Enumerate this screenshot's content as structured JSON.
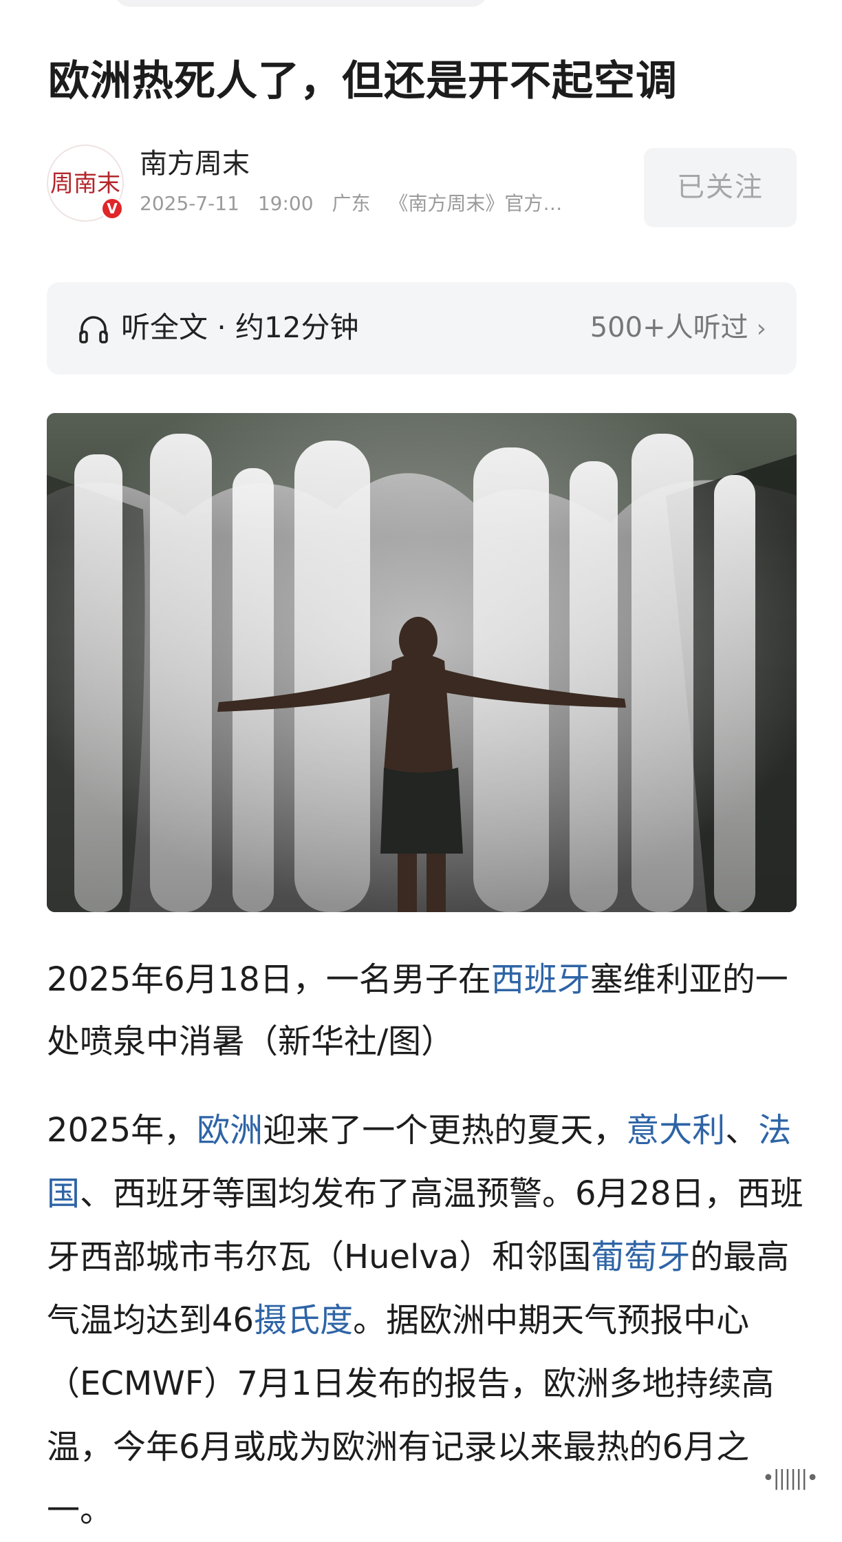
{
  "article": {
    "title": "欧洲热死人了，但还是开不起空调"
  },
  "author": {
    "name": "南方周末",
    "avatar_text": "周南末",
    "verified_mark": "V",
    "date": "2025-7-11",
    "time": "19:00",
    "location": "广东",
    "description": "《南方周末》官方…",
    "follow_label": "已关注"
  },
  "listen": {
    "icon": "headphones-icon",
    "label": "听全文 · 约12分钟",
    "listeners": "500+人听过"
  },
  "hero_image": {
    "description_icon": "photo-man-in-fountain"
  },
  "caption": {
    "part1": "2025年6月18日，一名男子在",
    "link1": "西班牙",
    "part2": "塞维利亚的一处喷泉中消暑（新华社/图）"
  },
  "body": {
    "t1": "2025年，",
    "link_europe": "欧洲",
    "t2": "迎来了一个更热的夏天，",
    "link_italy": "意大利",
    "t3": "、",
    "link_france": "法国",
    "t4": "、西班牙等国均发布了高温预警。6月28日，西班牙西部城市韦尔瓦（Huelva）和邻国",
    "link_portugal": "葡萄牙",
    "t5": "的最高气温均达到46",
    "link_celsius": "摄氏度",
    "t6": "。据欧洲中期天气预报中心（ECMWF）7月1日发布的报告，欧洲多地持续高温，今年6月或成为欧洲有记录以来最热的6月之一。"
  },
  "colors": {
    "link": "#2e64a6",
    "verified": "#e0262a",
    "avatar_red": "#b3262b"
  }
}
